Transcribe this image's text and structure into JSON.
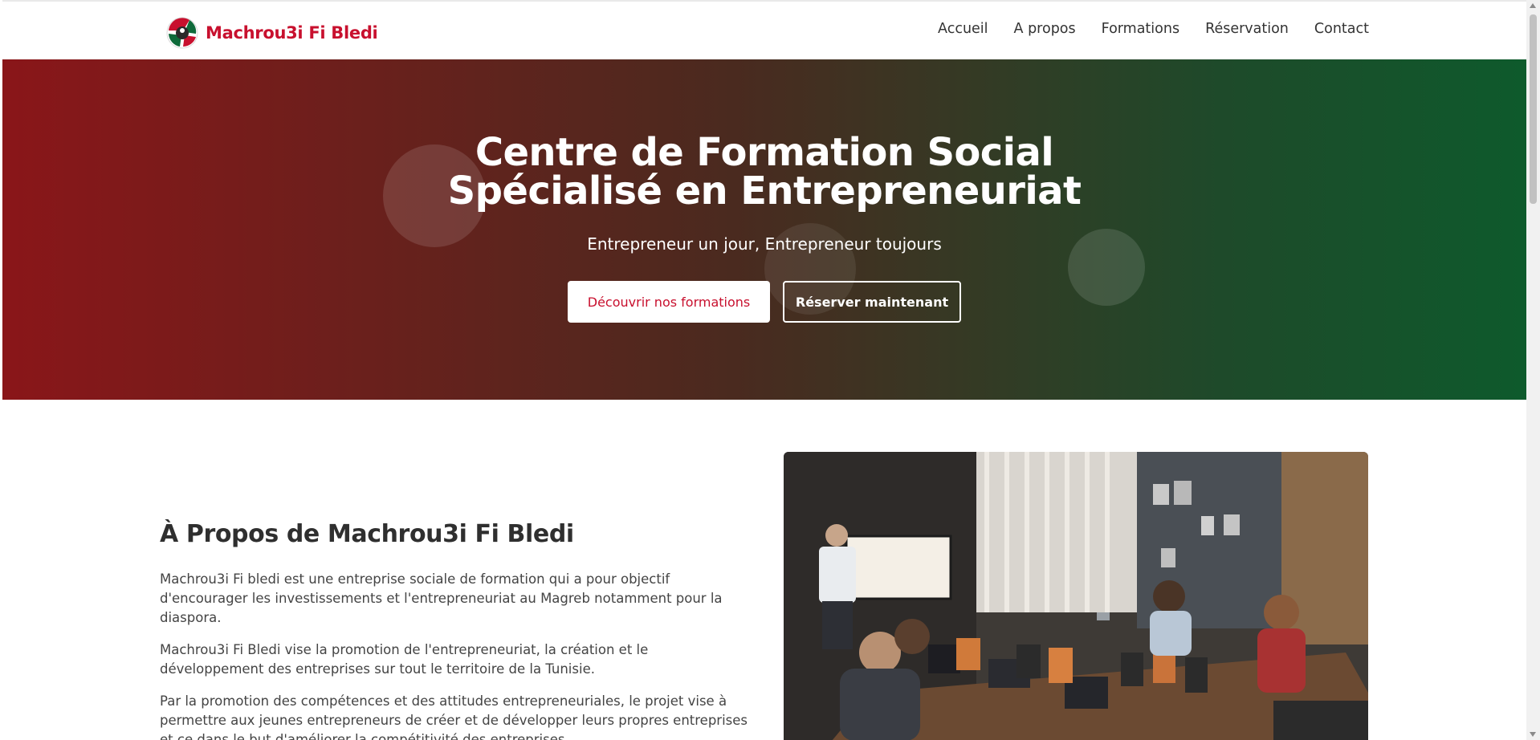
{
  "header": {
    "brand": "Machrou3i Fi Bledi",
    "nav": [
      "Accueil",
      "A propos",
      "Formations",
      "Réservation",
      "Contact"
    ]
  },
  "hero": {
    "title_line1": "Centre de Formation Social",
    "title_line2": "Spécialisé en Entrepreneuriat",
    "subtitle": "Entrepreneur un jour, Entrepreneur toujours",
    "btn_primary": "Découvrir nos formations",
    "btn_secondary": "Réserver maintenant"
  },
  "about": {
    "title": "À Propos de Machrou3i Fi Bledi",
    "paragraphs": [
      "Machrou3i Fi bledi est une entreprise sociale de formation qui a pour objectif d'encourager les investissements et l'entrepreneuriat au Magreb notamment pour la diaspora.",
      "Machrou3i Fi Bledi vise la promotion de l'entrepreneuriat, la création et le développement des entreprises sur tout le territoire de la Tunisie.",
      "Par la promotion des compétences et des attitudes entrepreneuriales, le projet vise à permettre aux jeunes entrepreneurs de créer et de développer leurs propres entreprises et ce dans le but d'améliorer la compétitivité des entreprises."
    ]
  },
  "colors": {
    "brand_red": "#c8102e",
    "hero_gradient_start": "#8a1619",
    "hero_gradient_end": "#0e5a2c"
  }
}
